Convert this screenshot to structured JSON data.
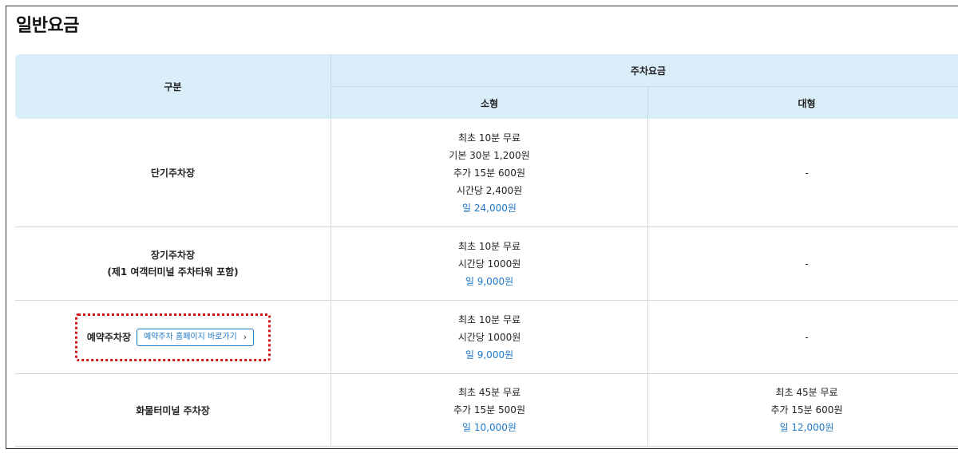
{
  "page_title": "일반요금",
  "table": {
    "header_category": "구분",
    "header_fee": "주차요금",
    "header_small": "소형",
    "header_large": "대형"
  },
  "rows": [
    {
      "name_lines": [
        "단기주차장"
      ],
      "small": [
        "최초 10분 무료",
        "기본 30분 1,200원",
        "추가 15분 600원",
        "시간당 2,400원"
      ],
      "small_daily": "일 24,000원",
      "large": [
        "-"
      ],
      "large_daily": ""
    },
    {
      "name_lines": [
        "장기주차장",
        "(제1 여객터미널 주차타워 포함)"
      ],
      "small": [
        "최초 10분 무료",
        "시간당 1000원"
      ],
      "small_daily": "일 9,000원",
      "large": [
        "-"
      ],
      "large_daily": ""
    },
    {
      "name": "예약주차장",
      "link_label": "예약주차 홈페이지 바로가기",
      "link_icon": "chevron-right-icon",
      "small": [
        "최초 10분 무료",
        "시간당 1000원"
      ],
      "small_daily": "일 9,000원",
      "large": [
        "-"
      ],
      "large_daily": ""
    },
    {
      "name_lines": [
        "화물터미널 주차장"
      ],
      "small": [
        "최초 45분 무료",
        "추가 15분 500원"
      ],
      "small_daily": "일 10,000원",
      "large": [
        "최초 45분 무료",
        "추가 15분 600원"
      ],
      "large_daily": "일 12,000원"
    }
  ],
  "colors": {
    "header_bg": "#daeefa",
    "daily_fee": "#1f78c8",
    "highlight_border": "#d41414"
  }
}
